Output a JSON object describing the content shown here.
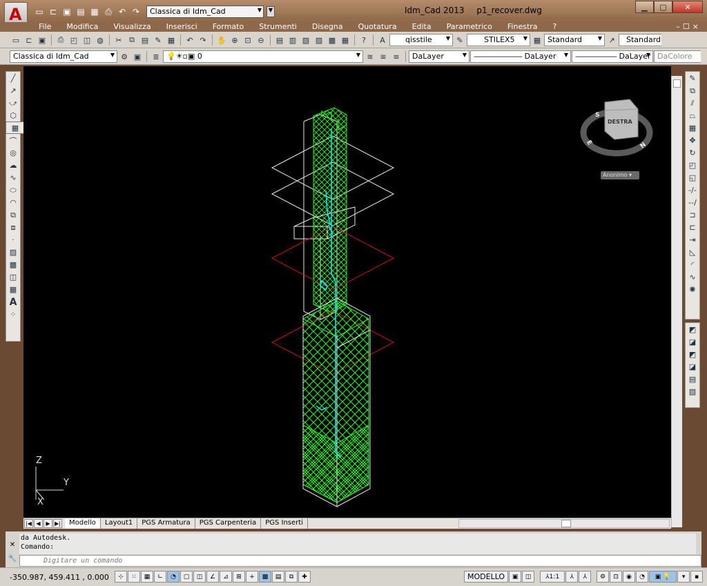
{
  "titlebar": {
    "workspace": "Classica di Idm_Cad",
    "app_name": "Idm_Cad 2013",
    "file_name": "p1_recover.dwg",
    "minimize": "▁",
    "maximize": "▢",
    "close": "✕"
  },
  "menu": {
    "items": [
      "File",
      "Modifica",
      "Visualizza",
      "Inserisci",
      "Formato",
      "Strumenti",
      "Disegna",
      "Quotatura",
      "Edita",
      "Parametrico",
      "Finestra",
      "?"
    ],
    "doc_controls": "–☐×"
  },
  "toolbar1": {
    "text_style": "qisstile",
    "dim_style": "STILEX5",
    "table_style": "Standard",
    "multileader_style": "Standard"
  },
  "toolbar2": {
    "workspace": "Classica di Idm_Cad",
    "layer": "0",
    "color": "DaLayer",
    "linetype": "DaLayer",
    "lineweight": "DaLayer",
    "plotstyle": "DaColore"
  },
  "viewcube": {
    "face": "DESTRA",
    "compass": [
      "S",
      "E",
      "N"
    ],
    "ucs": "Anonimo"
  },
  "ucs_icon": {
    "x": "X",
    "y": "Y",
    "z": "Z"
  },
  "tabs": [
    "Modello",
    "Layout1",
    "PGS Armatura",
    "PGS Carpenteria",
    "PGS Inserti"
  ],
  "command": {
    "history": [
      "da Autodesk.",
      "Comando:"
    ],
    "placeholder": "Digitare un comando"
  },
  "status": {
    "coords": "-350.987, 459.411 , 0.000",
    "space": "MODELLO",
    "scale": "1:1"
  },
  "colors": {
    "canvas": "#000000",
    "green": "#22ff22",
    "cyan": "#00e5ff",
    "red": "#cc1111",
    "white": "#e8e8e8"
  }
}
